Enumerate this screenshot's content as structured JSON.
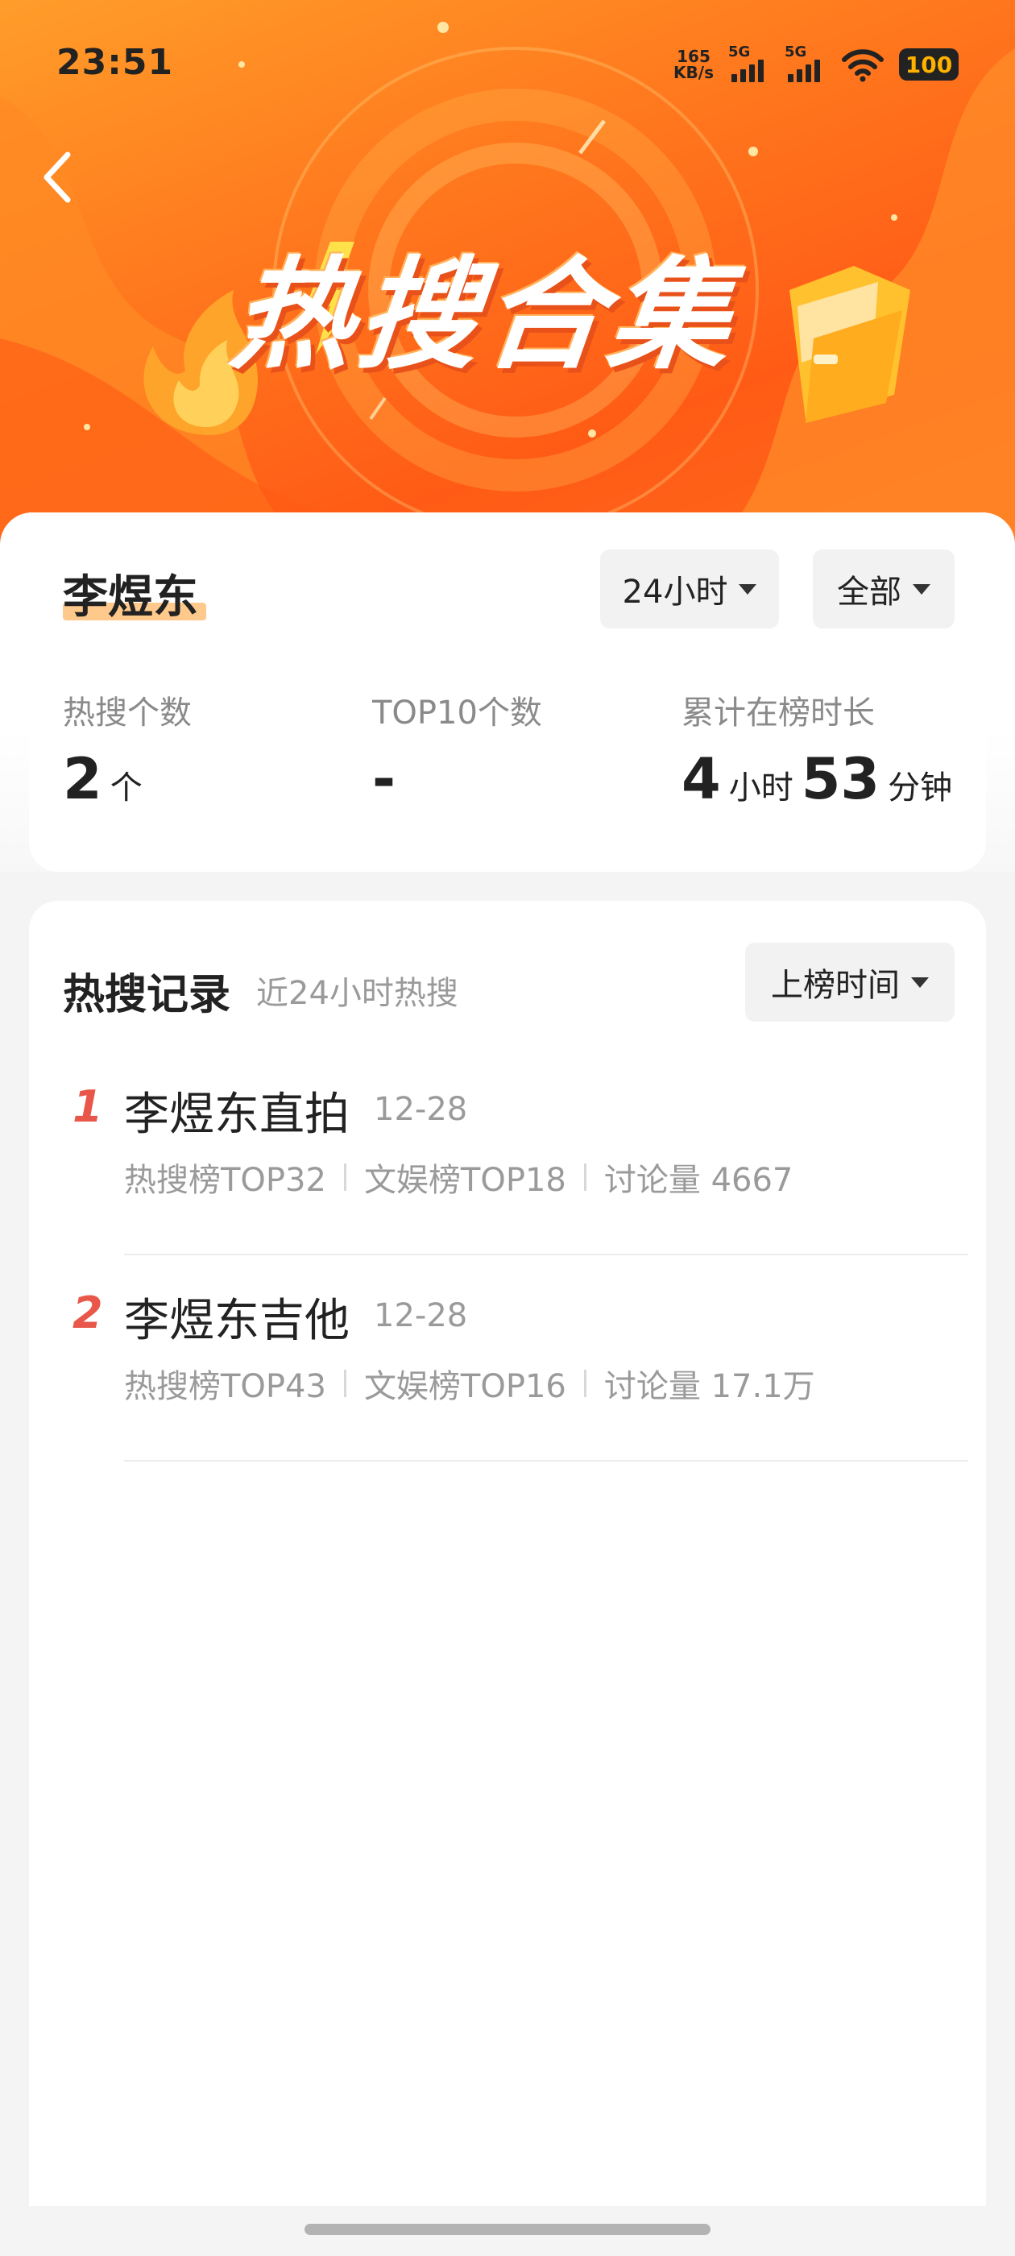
{
  "status_bar": {
    "time": "23:51",
    "net_speed_value": "165",
    "net_speed_unit": "KB/s",
    "sim1_label": "5G",
    "sim2_label": "5G",
    "battery": "100"
  },
  "hero": {
    "title": "热搜合集"
  },
  "profile": {
    "name": "李煜东",
    "filter_time": "24小时",
    "filter_scope": "全部",
    "stats": {
      "hot_count_label": "热搜个数",
      "hot_count_value": "2",
      "hot_count_unit": "个",
      "top10_label": "TOP10个数",
      "top10_value": "-",
      "duration_label": "累计在榜时长",
      "duration_hours": "4",
      "duration_hours_unit": "小时",
      "duration_minutes": "53",
      "duration_minutes_unit": "分钟"
    }
  },
  "records": {
    "title": "热搜记录",
    "subtitle": "近24小时热搜",
    "sort_label": "上榜时间",
    "items": [
      {
        "rank": "1",
        "title": "李煜东直拍",
        "date": "12-28",
        "hot_rank": "热搜榜TOP32",
        "ent_rank": "文娱榜TOP18",
        "discussion": "讨论量 4667"
      },
      {
        "rank": "2",
        "title": "李煜东吉他",
        "date": "12-28",
        "hot_rank": "热搜榜TOP43",
        "ent_rank": "文娱榜TOP16",
        "discussion": "讨论量 17.1万"
      }
    ]
  },
  "colors": {
    "accent_orange": "#ff6a1c",
    "rank_red": "#e8574a",
    "name_highlight": "#ffc98b"
  }
}
